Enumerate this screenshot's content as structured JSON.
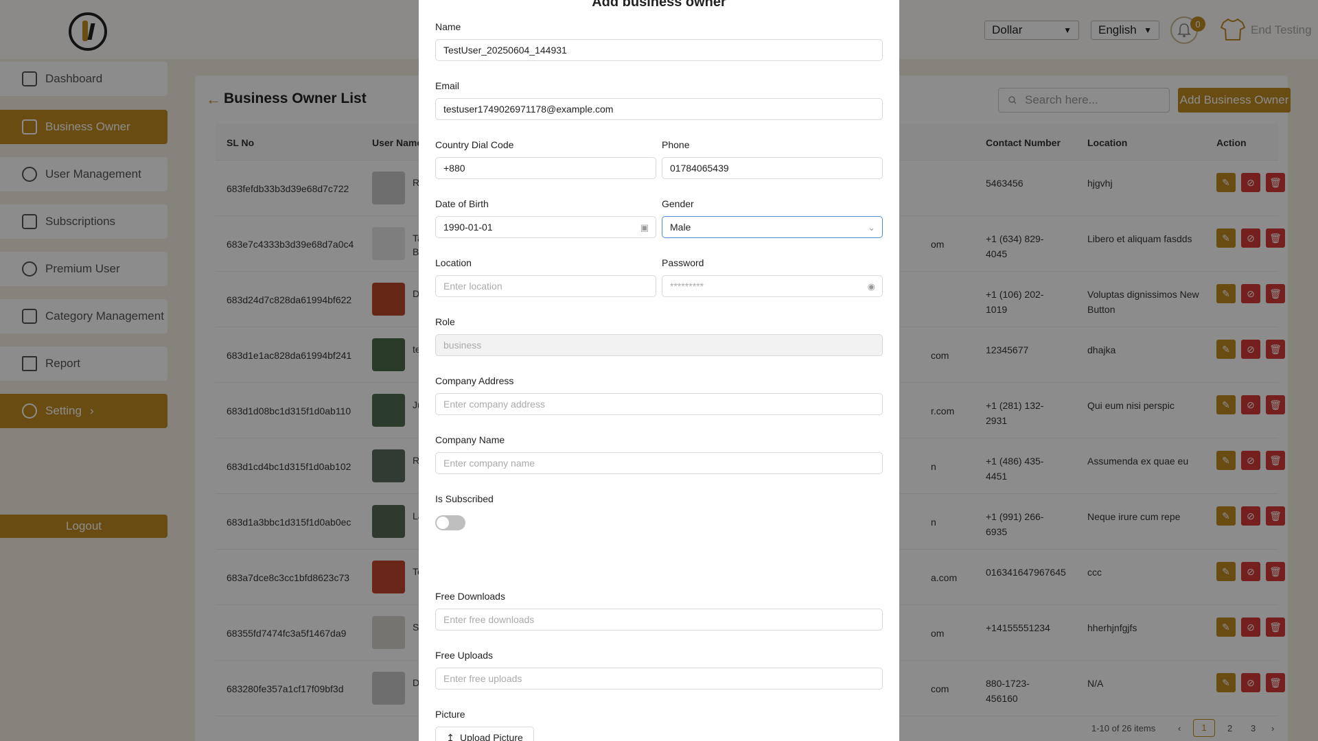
{
  "header": {
    "currency": "Dollar",
    "language": "English",
    "notification_count": "0",
    "end_testing": "End Testing"
  },
  "sidebar": {
    "items": [
      {
        "label": "Dashboard",
        "icon": "dashboard-icon"
      },
      {
        "label": "Business Owner",
        "icon": "briefcase-icon"
      },
      {
        "label": "User Management",
        "icon": "user-icon"
      },
      {
        "label": "Subscriptions",
        "icon": "document-icon"
      },
      {
        "label": "Premium User",
        "icon": "dollar-icon"
      },
      {
        "label": "Category Management",
        "icon": "shapes-icon"
      },
      {
        "label": "Report",
        "icon": "warning-icon"
      },
      {
        "label": "Setting",
        "icon": "gear-icon"
      }
    ],
    "logout": "Logout"
  },
  "page": {
    "title": "Business Owner List",
    "search_placeholder": "Search here...",
    "add_button": "Add Business Owner",
    "columns": {
      "sl": "SL No",
      "user": "User Name",
      "contact": "Contact Number",
      "location": "Location",
      "action": "Action"
    },
    "rows": [
      {
        "sl": "683fefdb33b3d39e68d7c722",
        "name": "R",
        "email_tail": "",
        "contact": "5463456",
        "location": "hjgvhj",
        "thumb": "#c9c9c9"
      },
      {
        "sl": "683e7c4333b3d39e68d7a0c4",
        "name": "Ta\nBe",
        "email_tail": "om",
        "contact": "+1 (634) 829-4045",
        "location": "Libero et aliquam fasdds",
        "thumb": "#e6e6e6"
      },
      {
        "sl": "683d24d7c828da61994bf622",
        "name": "D",
        "email_tail": "",
        "contact": "+1 (106) 202-1019",
        "location": "Voluptas dignissimos New Button",
        "thumb": "#b84a2a"
      },
      {
        "sl": "683d1e1ac828da61994bf241",
        "name": "te",
        "email_tail": "com",
        "contact": "12345677",
        "location": "dhajka",
        "thumb": "#4b6b4a"
      },
      {
        "sl": "683d1d08bc1d315f1d0ab110",
        "name": "Ju",
        "email_tail": "r.com",
        "contact": "+1 (281) 132-2931",
        "location": "Qui eum nisi perspic",
        "thumb": "#4f6e52"
      },
      {
        "sl": "683d1cd4bc1d315f1d0ab102",
        "name": "R",
        "email_tail": "n",
        "contact": "+1 (486) 435-4451",
        "location": "Assumenda ex quae eu",
        "thumb": "#5a6a5e"
      },
      {
        "sl": "683d1a3bbc1d315f1d0ab0ec",
        "name": "La",
        "email_tail": "n",
        "contact": "+1 (991) 266-6935",
        "location": "Neque irure cum repe",
        "thumb": "#566a57"
      },
      {
        "sl": "683a7dce8c3cc1bfd8623c73",
        "name": "Te",
        "email_tail": "a.com",
        "contact": "016341647967645",
        "location": "ccc",
        "thumb": "#c2452d"
      },
      {
        "sl": "68355fd7474fc3a5f1467da9",
        "name": "Sa",
        "email_tail": "om",
        "contact": "+14155551234",
        "location": "hherhjnfgjfs",
        "thumb": "#d8d3cc"
      },
      {
        "sl": "683280fe357a1cf17f09bf3d",
        "name": "D",
        "email_tail": "com",
        "contact": "880-1723-456160",
        "location": "N/A",
        "thumb": "#c9c9c9"
      }
    ],
    "pagination": {
      "summary": "1-10 of 26 items",
      "pages": [
        "1",
        "2",
        "3"
      ],
      "current": "1"
    }
  },
  "modal": {
    "title": "Add business owner",
    "name_label": "Name",
    "name_value": "TestUser_20250604_144931",
    "email_label": "Email",
    "email_value": "testuser1749026971178@example.com",
    "dial_label": "Country Dial Code",
    "dial_value": "+880",
    "phone_label": "Phone",
    "phone_value": "01784065439",
    "dob_label": "Date of Birth",
    "dob_value": "1990-01-01",
    "gender_label": "Gender",
    "gender_value": "Male",
    "location_label": "Location",
    "location_placeholder": "Enter location",
    "password_label": "Password",
    "password_value": "*********",
    "role_label": "Role",
    "role_value": "business",
    "company_address_label": "Company Address",
    "company_address_placeholder": "Enter company address",
    "company_name_label": "Company Name",
    "company_name_placeholder": "Enter company name",
    "subscribed_label": "Is Subscribed",
    "subscribed": false,
    "free_downloads_label": "Free Downloads",
    "free_downloads_placeholder": "Enter free downloads",
    "free_uploads_label": "Free Uploads",
    "free_uploads_placeholder": "Enter free uploads",
    "picture_label": "Picture",
    "upload_button": "Upload Picture"
  },
  "colors": {
    "accent": "#c08b22",
    "danger": "#d83a3a",
    "overlay": "rgba(0,0,0,0.45)"
  }
}
